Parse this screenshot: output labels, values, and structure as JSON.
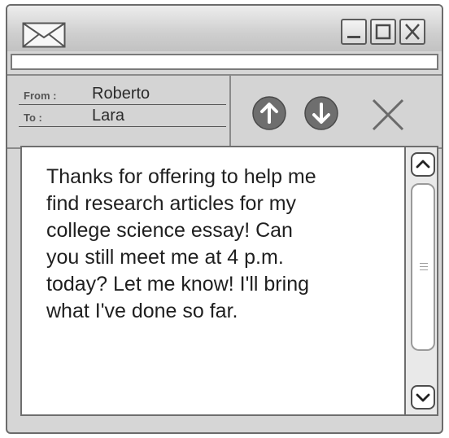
{
  "window": {
    "title_icon": "envelope-icon",
    "controls": [
      "minimize-icon",
      "maximize-icon",
      "close-icon"
    ]
  },
  "address_bar": {
    "value": ""
  },
  "header": {
    "from_label": "From :",
    "from_value": "Roberto",
    "to_label": "To :",
    "to_value": "Lara"
  },
  "actions": {
    "up_icon": "arrow-up-circle-icon",
    "down_icon": "arrow-down-circle-icon",
    "delete_icon": "x-icon"
  },
  "message": {
    "lines": [
      "Thanks for offering to help me",
      "find research articles for my",
      "college science essay! Can",
      "you still meet me at 4 p.m.",
      "today? Let me know! I'll bring",
      "what I've done so far."
    ]
  },
  "scrollbar": {
    "up_icon": "chevron-up-icon",
    "down_icon": "chevron-down-icon",
    "grip_icon": "grip-lines-icon"
  }
}
